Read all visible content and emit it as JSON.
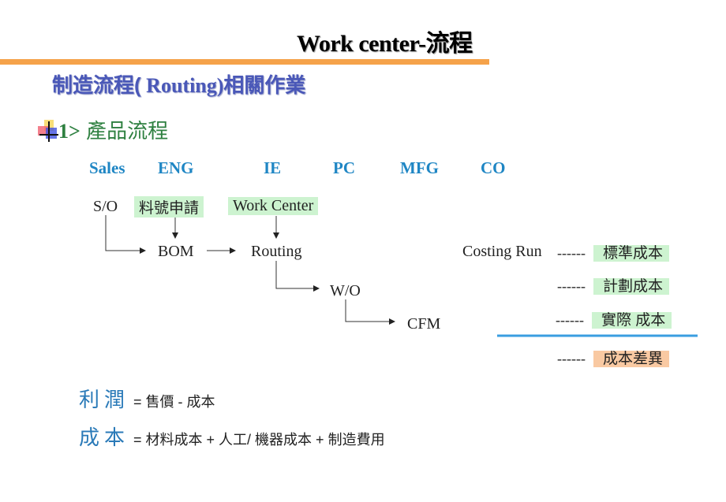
{
  "title": "Work center-流程",
  "subtitle": {
    "zh_prefix": "制造流程(",
    "latin": " Routing)",
    "zh_suffix": "相關作業"
  },
  "section": {
    "bullet_icon": "colorful-cross-bullet",
    "number": "1>",
    "label": "產品流程"
  },
  "departments": [
    "Sales",
    "ENG",
    "IE",
    "PC",
    "MFG",
    "CO"
  ],
  "flow": {
    "so": "S/O",
    "part_request": "料號申請",
    "work_center": "Work Center",
    "bom": "BOM",
    "routing": "Routing",
    "wo": "W/O",
    "cfm": "CFM",
    "costing_run": "Costing Run"
  },
  "costs": [
    {
      "dash": "------",
      "label": "標準成本",
      "highlight": "green"
    },
    {
      "dash": "------",
      "label": "計劃成本",
      "highlight": "green"
    },
    {
      "dash": "------",
      "label": "實際 成本",
      "highlight": "green"
    },
    {
      "dash": "------",
      "label": "成本差異",
      "highlight": "orange"
    }
  ],
  "formulas": [
    {
      "key": "利潤",
      "expr": "= 售價 - 成本"
    },
    {
      "key": "成本",
      "expr": "= 材料成本 + 人工/ 機器成本 + 制造費用"
    }
  ],
  "colors": {
    "orange_bar": "#f5a24a",
    "subtitle": "#4a58b8",
    "section": "#2e8040",
    "department": "#1f86c4",
    "highlight_green": "#cdf3d0",
    "highlight_orange": "#f9c9a2",
    "divider_blue": "#3a9ee0"
  }
}
